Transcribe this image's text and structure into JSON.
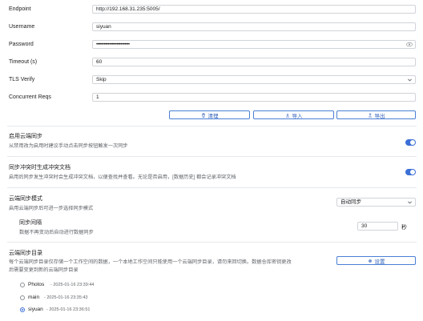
{
  "form": {
    "endpoint": {
      "label": "Endpoint",
      "value": "http://192.168.31.235:5005/"
    },
    "username": {
      "label": "Username",
      "value": "siyuan"
    },
    "password": {
      "label": "Password",
      "value": "••••••••••••••••••••••••••"
    },
    "timeout": {
      "label": "Timeout (s)",
      "value": "60"
    },
    "tls": {
      "label": "TLS Verify",
      "value": "Skip"
    },
    "concurrent": {
      "label": "Concurrent Reqs",
      "value": "1"
    }
  },
  "actions": {
    "clear": "清理",
    "import": "导入",
    "export": "导出"
  },
  "cloud_sync": {
    "title": "启用云端同步",
    "desc": "从禁用改为启用时建议手动点击同步按钮触发一次同步",
    "enabled": true
  },
  "conflict": {
    "title": "同步冲突时生成冲突文档",
    "desc": "启用后同步发生冲突时会生成冲突文档，以便查找并查看。无论是否启用，[数据历史] 都会记录冲突文档",
    "enabled": true
  },
  "mode": {
    "title": "云端同步模式",
    "desc": "启用云端同步后可进一步选择同步模式",
    "value": "自动同步",
    "interval_title": "同步间隔",
    "interval_desc": "数据不再变动后自动进行数据同步",
    "interval_value": "30",
    "interval_unit": "秒"
  },
  "dirs": {
    "title": "云端同步目录",
    "desc_line1": "每个云端同步目录仅存储一个工作空间的数据，一个本地工作空间只能使用一个云端同步目录，请勿来回切换。数据仓库密钥更改",
    "desc_line2": "后需要变更到新的云端同步目录",
    "settings_label": "设置",
    "items": [
      {
        "name": "Photos",
        "time": "2025-01-16 23:39:44",
        "selected": false
      },
      {
        "name": "main",
        "time": "2025-01-16 23:35:43",
        "selected": false
      },
      {
        "name": "siyuan",
        "time": "2025-01-16 23:36:51",
        "selected": true
      }
    ]
  },
  "colors": {
    "accent": "#3b6fd6",
    "button_text": "#2d5fb8"
  }
}
